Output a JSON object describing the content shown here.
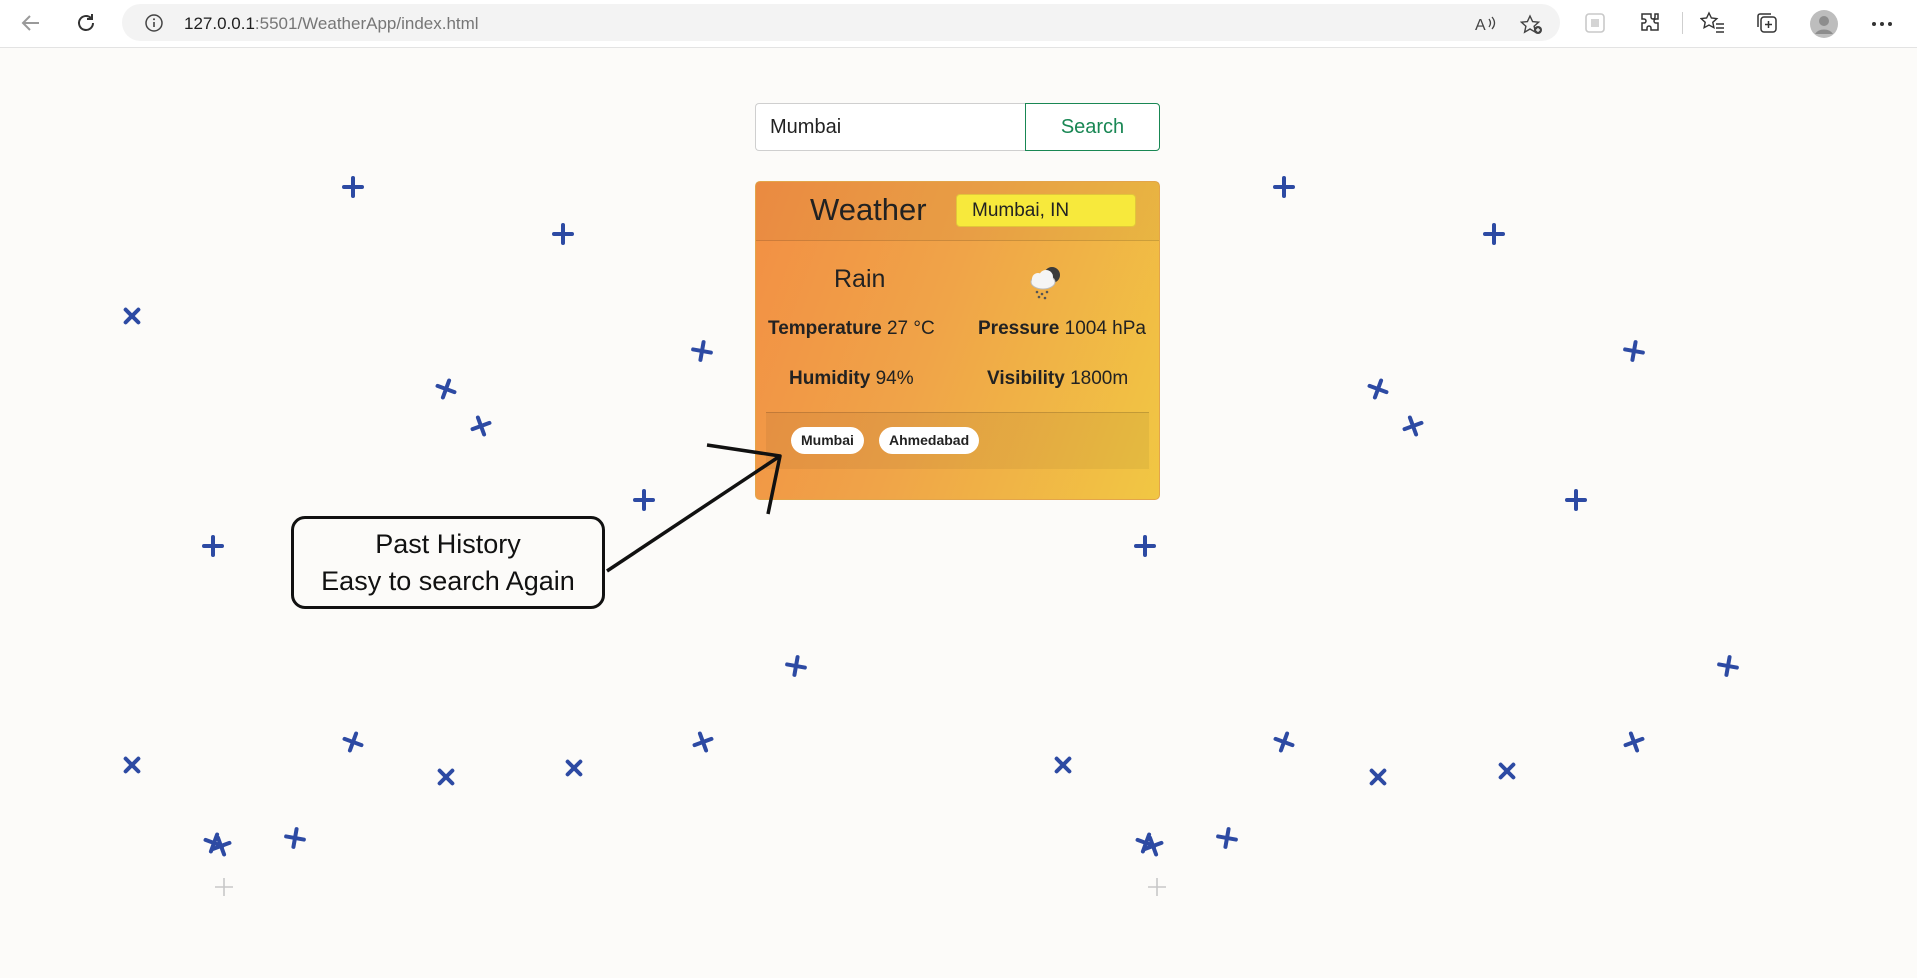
{
  "browser": {
    "url_host": "127.0.0.1",
    "url_rest": ":5501/WeatherApp/index.html"
  },
  "search": {
    "value": "Mumbai",
    "button_label": "Search"
  },
  "card": {
    "title": "Weather",
    "location": "Mumbai, IN",
    "condition": "Rain",
    "condition_icon": "rain-cloud-icon",
    "temperature_label": "Temperature",
    "temperature_value": "27 °C",
    "pressure_label": "Pressure",
    "pressure_value": "1004 hPa",
    "humidity_label": "Humidity",
    "humidity_value": "94%",
    "visibility_label": "Visibility",
    "visibility_value": "1800m"
  },
  "history": [
    "Mumbai",
    "Ahmedabad"
  ],
  "annotation": {
    "line1": "Past History",
    "line2": "Easy to search Again"
  },
  "colors": {
    "accent": "#198754",
    "card_gradient_start": "#f28f44",
    "card_gradient_end": "#f1c743",
    "badge": "#f7e93c",
    "marks": "#2d4aa3"
  }
}
